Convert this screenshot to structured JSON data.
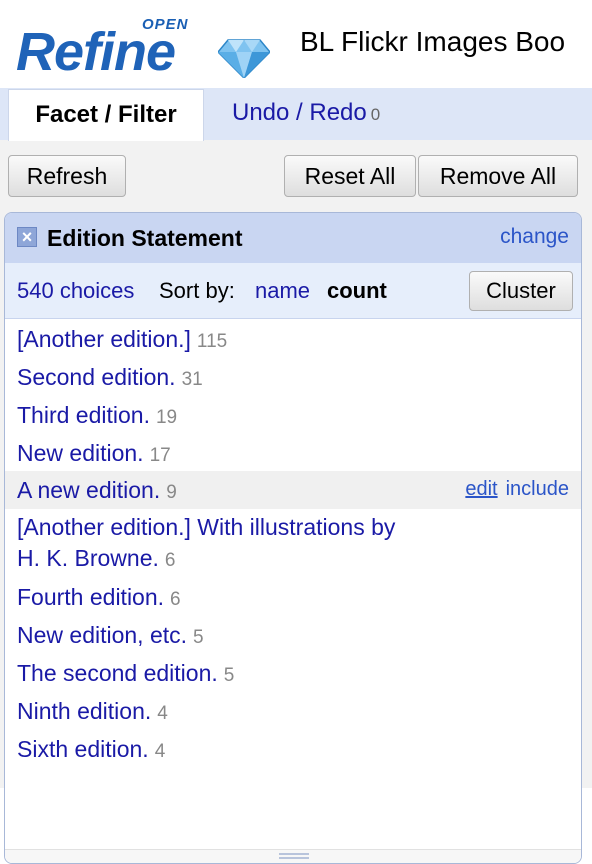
{
  "header": {
    "logo_open": "OPEN",
    "logo_refine": "Refine",
    "project_title": "BL Flickr Images Boo"
  },
  "tabs": [
    {
      "label": "Facet / Filter",
      "active": true
    },
    {
      "label": "Undo / Redo",
      "count": "0",
      "active": false
    }
  ],
  "toolbar": {
    "refresh_label": "Refresh",
    "reset_all_label": "Reset All",
    "remove_all_label": "Remove All"
  },
  "facet": {
    "title": "Edition Statement",
    "change_label": "change",
    "choices_count": "540 choices",
    "sort_label": "Sort by:",
    "sort_name": "name",
    "sort_count": "count",
    "cluster_label": "Cluster",
    "hover_actions": {
      "edit": "edit",
      "include": "include"
    },
    "choices": [
      {
        "label": "[Another edition.]",
        "count": "115"
      },
      {
        "label": "Second edition.",
        "count": "31"
      },
      {
        "label": "Third edition.",
        "count": "19"
      },
      {
        "label": "New edition.",
        "count": "17"
      },
      {
        "label": "A new edition.",
        "count": "9"
      },
      {
        "label_line1": "[Another edition.] With illustrations by",
        "label_line2": "H. K. Browne.",
        "count": "6"
      },
      {
        "label": "Fourth edition.",
        "count": "6"
      },
      {
        "label": "New edition, etc.",
        "count": "5"
      },
      {
        "label": "The second edition.",
        "count": "5"
      },
      {
        "label": "Ninth edition.",
        "count": "4"
      },
      {
        "label": "Sixth edition.",
        "count": "4"
      }
    ]
  },
  "colors": {
    "link": "#1a1aa6",
    "tab_bar": "#dde6f7",
    "facet_header": "#c9d6f2",
    "logo_blue": "#1f63b8"
  }
}
